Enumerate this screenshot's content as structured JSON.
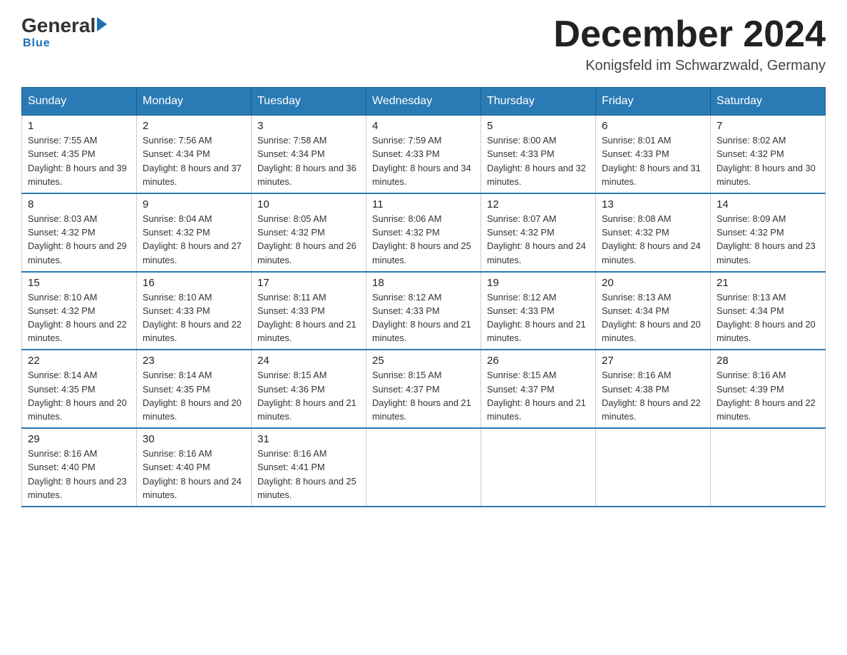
{
  "logo": {
    "general": "General",
    "blue": "Blue",
    "underline": "Blue"
  },
  "title": "December 2024",
  "subtitle": "Konigsfeld im Schwarzwald, Germany",
  "headers": [
    "Sunday",
    "Monday",
    "Tuesday",
    "Wednesday",
    "Thursday",
    "Friday",
    "Saturday"
  ],
  "weeks": [
    [
      {
        "day": "1",
        "sunrise": "7:55 AM",
        "sunset": "4:35 PM",
        "daylight": "8 hours and 39 minutes."
      },
      {
        "day": "2",
        "sunrise": "7:56 AM",
        "sunset": "4:34 PM",
        "daylight": "8 hours and 37 minutes."
      },
      {
        "day": "3",
        "sunrise": "7:58 AM",
        "sunset": "4:34 PM",
        "daylight": "8 hours and 36 minutes."
      },
      {
        "day": "4",
        "sunrise": "7:59 AM",
        "sunset": "4:33 PM",
        "daylight": "8 hours and 34 minutes."
      },
      {
        "day": "5",
        "sunrise": "8:00 AM",
        "sunset": "4:33 PM",
        "daylight": "8 hours and 32 minutes."
      },
      {
        "day": "6",
        "sunrise": "8:01 AM",
        "sunset": "4:33 PM",
        "daylight": "8 hours and 31 minutes."
      },
      {
        "day": "7",
        "sunrise": "8:02 AM",
        "sunset": "4:32 PM",
        "daylight": "8 hours and 30 minutes."
      }
    ],
    [
      {
        "day": "8",
        "sunrise": "8:03 AM",
        "sunset": "4:32 PM",
        "daylight": "8 hours and 29 minutes."
      },
      {
        "day": "9",
        "sunrise": "8:04 AM",
        "sunset": "4:32 PM",
        "daylight": "8 hours and 27 minutes."
      },
      {
        "day": "10",
        "sunrise": "8:05 AM",
        "sunset": "4:32 PM",
        "daylight": "8 hours and 26 minutes."
      },
      {
        "day": "11",
        "sunrise": "8:06 AM",
        "sunset": "4:32 PM",
        "daylight": "8 hours and 25 minutes."
      },
      {
        "day": "12",
        "sunrise": "8:07 AM",
        "sunset": "4:32 PM",
        "daylight": "8 hours and 24 minutes."
      },
      {
        "day": "13",
        "sunrise": "8:08 AM",
        "sunset": "4:32 PM",
        "daylight": "8 hours and 24 minutes."
      },
      {
        "day": "14",
        "sunrise": "8:09 AM",
        "sunset": "4:32 PM",
        "daylight": "8 hours and 23 minutes."
      }
    ],
    [
      {
        "day": "15",
        "sunrise": "8:10 AM",
        "sunset": "4:32 PM",
        "daylight": "8 hours and 22 minutes."
      },
      {
        "day": "16",
        "sunrise": "8:10 AM",
        "sunset": "4:33 PM",
        "daylight": "8 hours and 22 minutes."
      },
      {
        "day": "17",
        "sunrise": "8:11 AM",
        "sunset": "4:33 PM",
        "daylight": "8 hours and 21 minutes."
      },
      {
        "day": "18",
        "sunrise": "8:12 AM",
        "sunset": "4:33 PM",
        "daylight": "8 hours and 21 minutes."
      },
      {
        "day": "19",
        "sunrise": "8:12 AM",
        "sunset": "4:33 PM",
        "daylight": "8 hours and 21 minutes."
      },
      {
        "day": "20",
        "sunrise": "8:13 AM",
        "sunset": "4:34 PM",
        "daylight": "8 hours and 20 minutes."
      },
      {
        "day": "21",
        "sunrise": "8:13 AM",
        "sunset": "4:34 PM",
        "daylight": "8 hours and 20 minutes."
      }
    ],
    [
      {
        "day": "22",
        "sunrise": "8:14 AM",
        "sunset": "4:35 PM",
        "daylight": "8 hours and 20 minutes."
      },
      {
        "day": "23",
        "sunrise": "8:14 AM",
        "sunset": "4:35 PM",
        "daylight": "8 hours and 20 minutes."
      },
      {
        "day": "24",
        "sunrise": "8:15 AM",
        "sunset": "4:36 PM",
        "daylight": "8 hours and 21 minutes."
      },
      {
        "day": "25",
        "sunrise": "8:15 AM",
        "sunset": "4:37 PM",
        "daylight": "8 hours and 21 minutes."
      },
      {
        "day": "26",
        "sunrise": "8:15 AM",
        "sunset": "4:37 PM",
        "daylight": "8 hours and 21 minutes."
      },
      {
        "day": "27",
        "sunrise": "8:16 AM",
        "sunset": "4:38 PM",
        "daylight": "8 hours and 22 minutes."
      },
      {
        "day": "28",
        "sunrise": "8:16 AM",
        "sunset": "4:39 PM",
        "daylight": "8 hours and 22 minutes."
      }
    ],
    [
      {
        "day": "29",
        "sunrise": "8:16 AM",
        "sunset": "4:40 PM",
        "daylight": "8 hours and 23 minutes."
      },
      {
        "day": "30",
        "sunrise": "8:16 AM",
        "sunset": "4:40 PM",
        "daylight": "8 hours and 24 minutes."
      },
      {
        "day": "31",
        "sunrise": "8:16 AM",
        "sunset": "4:41 PM",
        "daylight": "8 hours and 25 minutes."
      },
      null,
      null,
      null,
      null
    ]
  ]
}
